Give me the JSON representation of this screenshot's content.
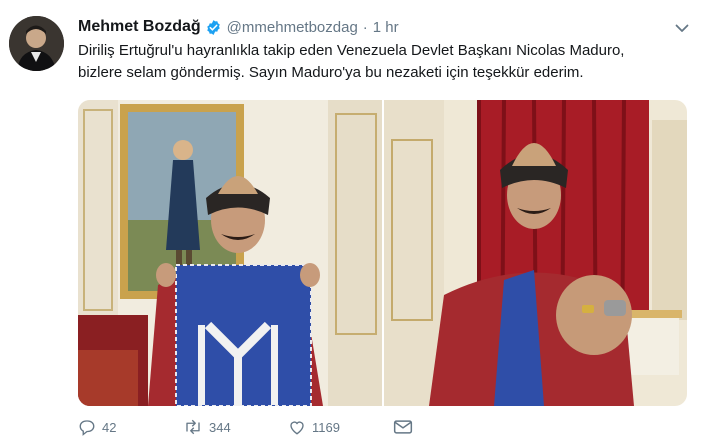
{
  "tweet": {
    "display_name": "Mehmet Bozdağ",
    "handle": "@mmehmetbozdag",
    "separator": "·",
    "time": "1 hr",
    "text_line_1": "Diriliş Ertuğrul'u hayranlıkla takip eden Venezuela Devlet Başkanı Nicolas Maduro,",
    "text_line_2": "bizlere selam göndermiş. Sayın Maduro'ya  bu nezaketi için teşekkür ederim."
  },
  "actions": {
    "reply_count": "42",
    "retweet_count": "344",
    "like_count": "1169"
  },
  "icons": {
    "verified": "verified-badge-icon",
    "caret": "chevron-down-icon",
    "reply": "reply-icon",
    "retweet": "retweet-icon",
    "like": "heart-icon",
    "dm": "mail-icon"
  },
  "colors": {
    "accent": "#1da1f2",
    "muted": "#657786",
    "text": "#14171a"
  }
}
